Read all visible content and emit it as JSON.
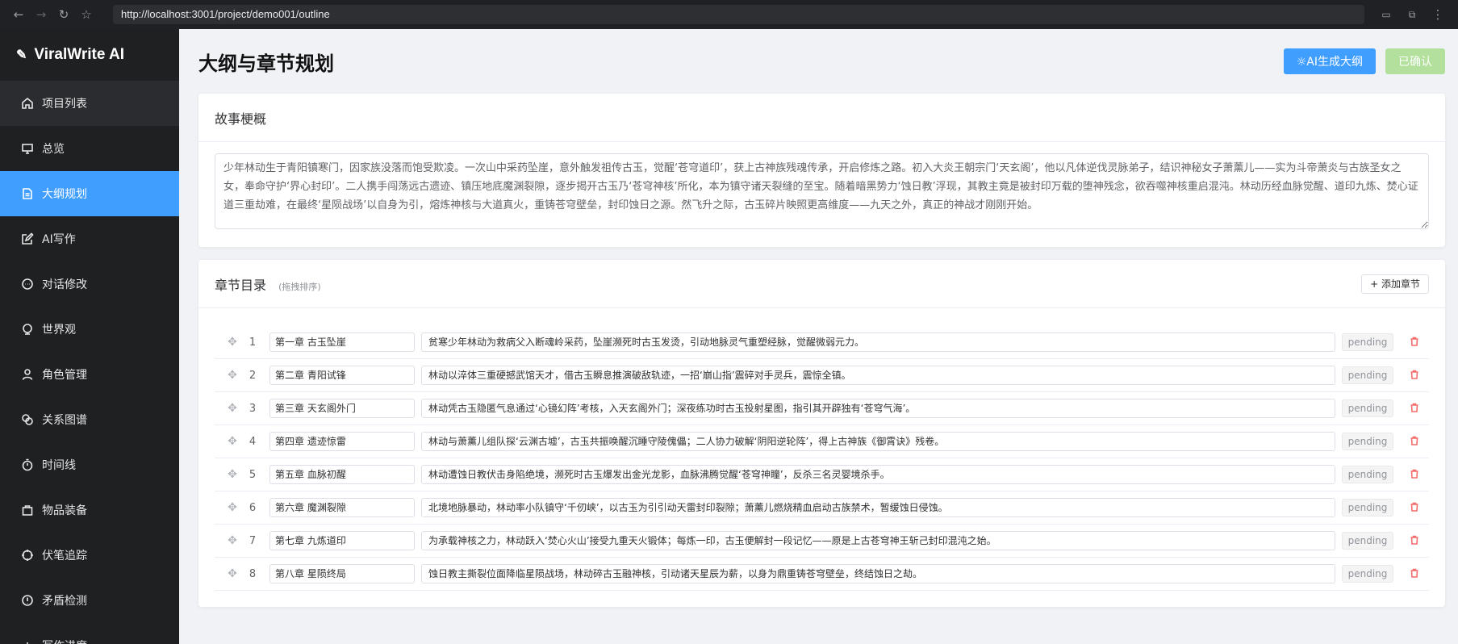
{
  "browser": {
    "url": "http://localhost:3001/project/demo001/outline"
  },
  "brand": {
    "name": "ViralWrite AI"
  },
  "sidebar": {
    "items": [
      {
        "label": "项目列表",
        "icon": "home-icon"
      },
      {
        "label": "总览",
        "icon": "monitor-icon"
      },
      {
        "label": "大纲规划",
        "icon": "document-icon"
      },
      {
        "label": "AI写作",
        "icon": "edit-icon"
      },
      {
        "label": "对话修改",
        "icon": "chat-icon"
      },
      {
        "label": "世界观",
        "icon": "globe-icon"
      },
      {
        "label": "角色管理",
        "icon": "user-icon"
      },
      {
        "label": "关系图谱",
        "icon": "link-icon"
      },
      {
        "label": "时间线",
        "icon": "timer-icon"
      },
      {
        "label": "物品装备",
        "icon": "bag-icon"
      },
      {
        "label": "伏笔追踪",
        "icon": "target-icon"
      },
      {
        "label": "矛盾检测",
        "icon": "warning-icon"
      },
      {
        "label": "写作进度",
        "icon": "chart-icon"
      }
    ],
    "active_index": 2
  },
  "page": {
    "title": "大纲与章节规划",
    "generate_button": "☼AI生成大纲",
    "confirm_button": "已确认"
  },
  "synopsis": {
    "title": "故事梗概",
    "text": "少年林动生于青阳镇寒门，因家族没落而饱受欺凌。一次山中采药坠崖，意外触发祖传古玉，觉醒‘苍穹道印’，获上古神族残魂传承，开启修炼之路。初入大炎王朝宗门‘天玄阁’，他以凡体逆伐灵脉弟子，结识神秘女子萧薰儿——实为斗帝萧炎与古族圣女之女，奉命守护‘界心封印’。二人携手闯荡远古遗迹、镇压地底魔渊裂隙，逐步揭开古玉乃‘苍穹神核’所化，本为镇守诸天裂缝的至宝。随着暗黑势力‘蚀日教’浮现，其教主竟是被封印万载的堕神残念，欲吞噬神核重启混沌。林动历经血脉觉醒、道印九炼、焚心证道三重劫难，在最终‘星陨战场’以自身为引，熔炼神核与大道真火，重铸苍穹壁垒，封印蚀日之源。然飞升之际，古玉碎片映照更高维度——九天之外，真正的神战才刚刚开始。"
  },
  "chapters": {
    "title": "章节目录",
    "hint": "(拖拽排序)",
    "add_button": "+ 添加章节",
    "rows": [
      {
        "num": "1",
        "title": "第一章 古玉坠崖",
        "summary": "贫寒少年林动为救病父入断魂岭采药，坠崖濒死时古玉发烫，引动地脉灵气重塑经脉，觉醒微弱元力。",
        "status": "pending"
      },
      {
        "num": "2",
        "title": "第二章 青阳试锋",
        "summary": "林动以淬体三重硬撼武馆天才，借古玉瞬息推演破敌轨迹，一招‘崩山指’震碎对手灵兵，震惊全镇。",
        "status": "pending"
      },
      {
        "num": "3",
        "title": "第三章 天玄阁外门",
        "summary": "林动凭古玉隐匿气息通过‘心镜幻阵’考核，入天玄阁外门；深夜练功时古玉投射星图，指引其开辟独有‘苍穹气海’。",
        "status": "pending"
      },
      {
        "num": "4",
        "title": "第四章 遗迹惊雷",
        "summary": "林动与萧薰儿组队探‘云渊古墟’，古玉共振唤醒沉睡守陵傀儡；二人协力破解‘阴阳逆轮阵’，得上古神族《御霄诀》残卷。",
        "status": "pending"
      },
      {
        "num": "5",
        "title": "第五章 血脉初醒",
        "summary": "林动遭蚀日教伏击身陷绝境，濒死时古玉爆发出金光龙影，血脉沸腾觉醒‘苍穹神瞳’，反杀三名灵婴境杀手。",
        "status": "pending"
      },
      {
        "num": "6",
        "title": "第六章 魔渊裂隙",
        "summary": "北境地脉暴动，林动率小队镇守‘千仞峡’，以古玉为引引动天雷封印裂隙；萧薰儿燃烧精血启动古族禁术，暂缓蚀日侵蚀。",
        "status": "pending"
      },
      {
        "num": "7",
        "title": "第七章 九炼道印",
        "summary": "为承载神核之力，林动跃入‘焚心火山’接受九重天火锻体；每炼一印，古玉便解封一段记忆——原是上古苍穹神王斩己封印混沌之始。",
        "status": "pending"
      },
      {
        "num": "8",
        "title": "第八章 星陨终局",
        "summary": "蚀日教主撕裂位面降临星陨战场，林动碎古玉融神核，引动诸天星辰为薪，以身为鼎重铸苍穹壁垒，终结蚀日之劫。",
        "status": "pending"
      }
    ]
  },
  "colors": {
    "accent": "#409eff",
    "sidebar_bg": "#1f2022",
    "confirm_disabled": "#b3e19d",
    "delete": "#f56c6c"
  }
}
